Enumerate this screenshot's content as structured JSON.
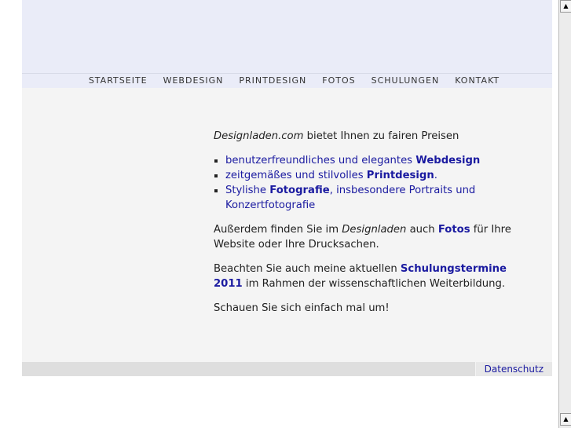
{
  "nav": [
    "STARTSEITE",
    "WEBDESIGN",
    "PRINTDESIGN",
    "FOTOS",
    "SCHULUNGEN",
    "KONTAKT"
  ],
  "intro": {
    "brand": "Designladen.com",
    "text": " bietet Ihnen zu fairen Preisen"
  },
  "list": [
    {
      "pre": "benutzerfreundliches und elegantes ",
      "bold": "Webdesign",
      "post": ""
    },
    {
      "pre": "zeitgemäßes und stilvolles ",
      "bold": "Printdesign",
      "post": "."
    },
    {
      "pre": "Stylishe ",
      "bold": "Fotografie",
      "post": ", insbesondere Portraits und Konzertfotografie"
    }
  ],
  "p2": {
    "a": "Außerdem finden Sie im ",
    "em": "Designladen",
    "b": " auch ",
    "link": "Fotos",
    "c": " für Ihre Website oder Ihre Drucksachen."
  },
  "p3": {
    "a": "Beachten Sie auch meine aktuellen ",
    "link": "Schulungstermine 2011",
    "b": " im Rahmen der wissenschaftlichen Weiterbildung."
  },
  "p4": "Schauen Sie sich einfach mal um!",
  "footer": {
    "datenschutz": "Datenschutz"
  },
  "scroll": {
    "up": "▲",
    "down": "▲"
  }
}
